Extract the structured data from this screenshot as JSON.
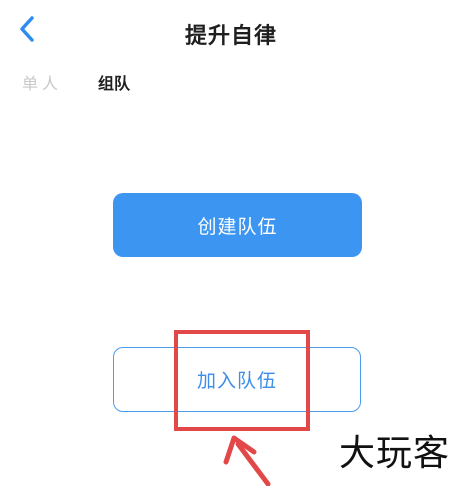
{
  "header": {
    "title": "提升自律"
  },
  "tabs": [
    {
      "label": "单人",
      "active": false
    },
    {
      "label": "组队",
      "active": true
    }
  ],
  "actions": {
    "create_label": "创建队伍",
    "join_label": "加入队伍"
  },
  "watermark": "大玩客",
  "colors": {
    "accent": "#3d95f2",
    "annotation": "#e24848"
  },
  "icons": {
    "back": "chevron-left-icon",
    "pointer": "red-arrow-annotation"
  }
}
